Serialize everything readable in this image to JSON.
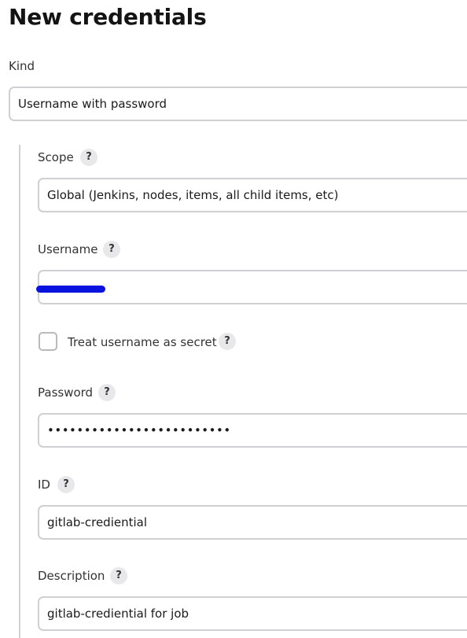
{
  "page": {
    "title": "New credentials"
  },
  "kind": {
    "label": "Kind",
    "value": "Username with password"
  },
  "scope": {
    "label": "Scope",
    "help": "?",
    "value": "Global (Jenkins, nodes, items, all child items, etc)"
  },
  "username": {
    "label": "Username",
    "help": "?",
    "value": ""
  },
  "treat_secret": {
    "label": "Treat username as secret",
    "help": "?",
    "checked": false
  },
  "password": {
    "label": "Password",
    "help": "?",
    "value": "•••••••••••••••••••••••••"
  },
  "id": {
    "label": "ID",
    "help": "?",
    "value": "gitlab-crediential"
  },
  "description": {
    "label": "Description",
    "help": "?",
    "value": "gitlab-crediential for job"
  },
  "colors": {
    "redaction": "#0a12e0",
    "border": "#cfcfd4",
    "help_bg": "#e8e8ea"
  }
}
